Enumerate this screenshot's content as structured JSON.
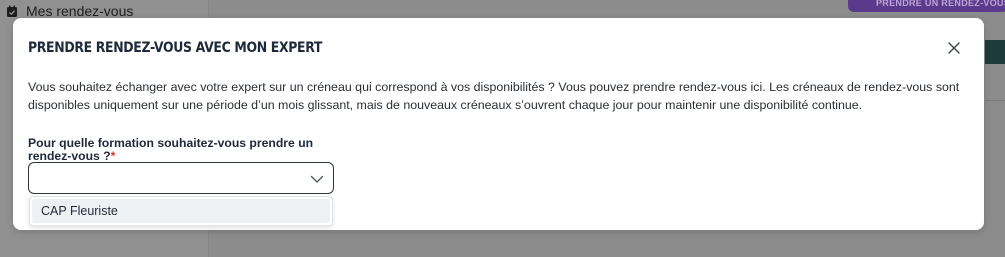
{
  "background": {
    "nav_item_label": "Mes rendez-vous",
    "cta_label": "PRENDRE UN RENDEZ-VOUS EN LIGNE"
  },
  "modal": {
    "title": "PRENDRE RENDEZ-VOUS AVEC MON EXPERT",
    "close_icon": "close-icon",
    "description": "Vous souhaitez échanger avec votre expert sur un créneau qui correspond à vos disponibilités ? Vous pouvez prendre rendez-vous ici. Les créneaux de rendez-vous sont disponibles uniquement sur une période d’un mois glissant, mais de nouveaux créneaux s’ouvrent chaque jour pour maintenir une disponibilité continue.",
    "field": {
      "label": "Pour quelle formation souhaitez-vous prendre un rendez-vous ?",
      "required_marker": "*",
      "selected_value": "",
      "options": [
        "CAP Fleuriste"
      ]
    }
  },
  "colors": {
    "overlay": "#8c8c8c",
    "required": "#d9342b",
    "cta": "#5b3a8c",
    "option_highlight": "#eef1f4"
  }
}
